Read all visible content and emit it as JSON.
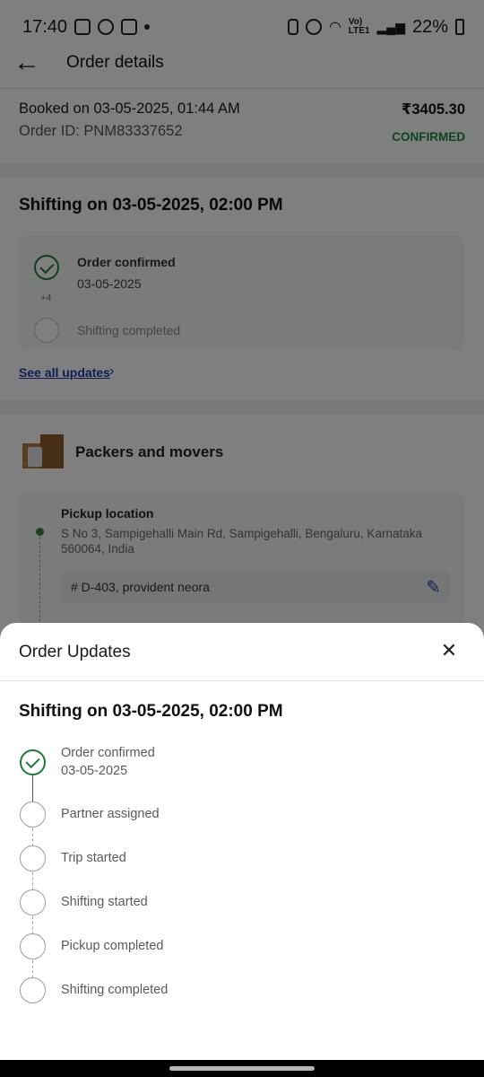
{
  "status_bar": {
    "time": "17:40",
    "volte": "Vo)",
    "lte": "LTE1",
    "battery": "22%"
  },
  "app_bar": {
    "title": "Order details"
  },
  "booking": {
    "booked_on": "Booked on 03-05-2025, 01:44 AM",
    "order_id": "Order ID: PNM83337652",
    "price": "₹3405.30",
    "status": "CONFIRMED"
  },
  "shifting_summary": {
    "title": "Shifting on 03-05-2025, 02:00 PM",
    "first_step": {
      "label": "Order confirmed",
      "date": "03-05-2025"
    },
    "more_count": "+4",
    "last_step": {
      "label": "Shifting completed"
    },
    "see_all": "See all updates"
  },
  "service": {
    "title": "Packers and movers",
    "pickup_label": "Pickup location",
    "pickup_address": "S No 3, Sampigehalli Main Rd, Sampigehalli, Bengaluru, Karnataka 560064, India",
    "pickup_detail": "# D-403, provident neora"
  },
  "sheet": {
    "title": "Order Updates",
    "close_symbol": "✕",
    "subtitle": "Shifting on 03-05-2025, 02:00 PM",
    "steps": [
      {
        "label": "Order confirmed",
        "date": "03-05-2025",
        "done": true
      },
      {
        "label": "Partner assigned",
        "done": false
      },
      {
        "label": "Trip started",
        "done": false
      },
      {
        "label": "Shifting started",
        "done": false
      },
      {
        "label": "Pickup completed",
        "done": false
      },
      {
        "label": "Shifting completed",
        "done": false
      }
    ]
  },
  "colors": {
    "accent_green": "#1e7a3a",
    "link_blue": "#1a3ea8",
    "scrim": "rgba(0,0,0,0.5)"
  }
}
